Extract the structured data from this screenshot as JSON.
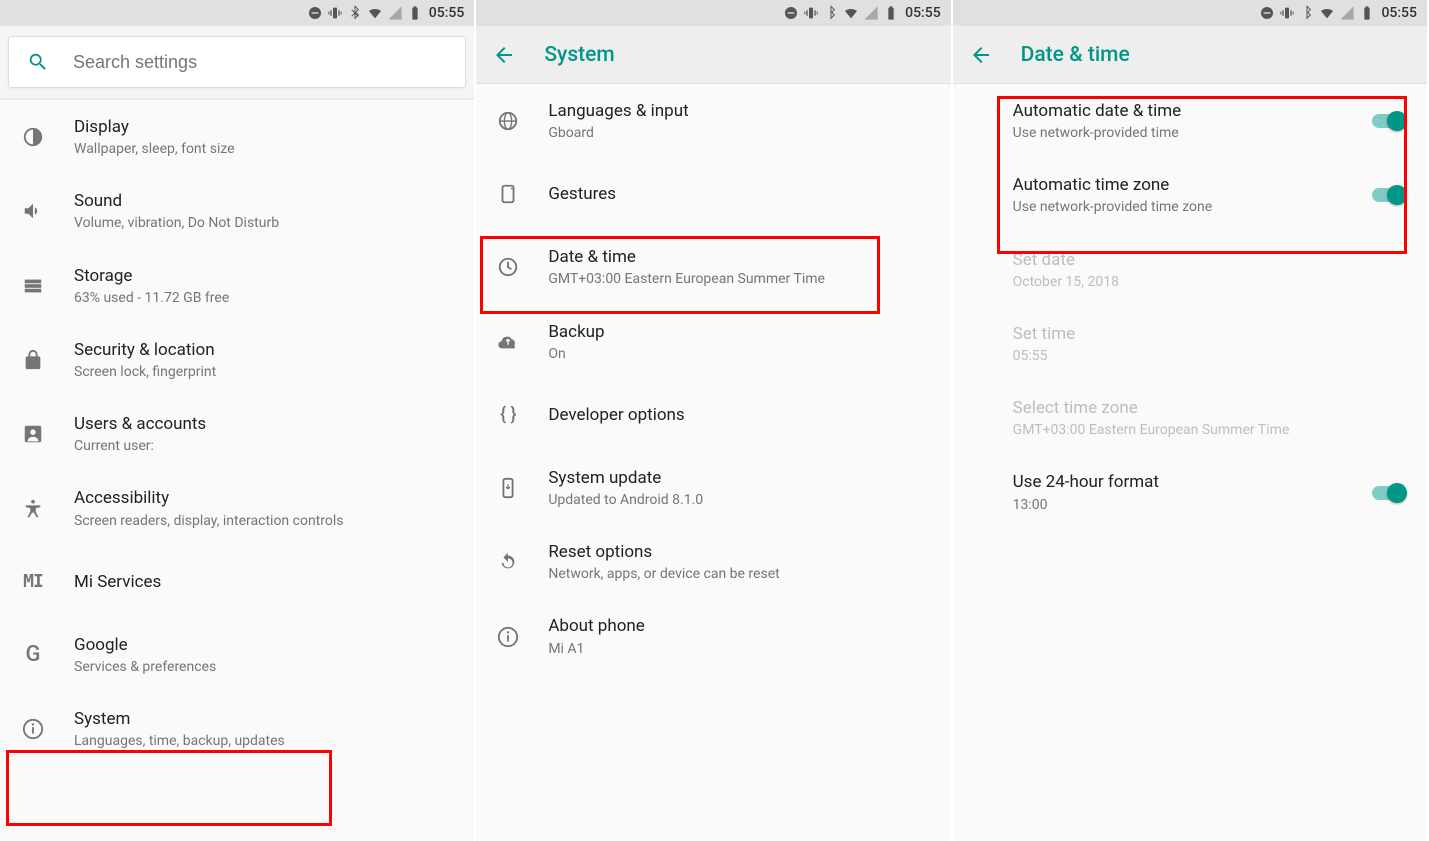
{
  "status": {
    "time": "05:55"
  },
  "panel1": {
    "search_placeholder": "Search settings",
    "items": [
      {
        "title": "Display",
        "subtitle": "Wallpaper, sleep, font size"
      },
      {
        "title": "Sound",
        "subtitle": "Volume, vibration, Do Not Disturb"
      },
      {
        "title": "Storage",
        "subtitle": "63% used - 11.72 GB free"
      },
      {
        "title": "Security & location",
        "subtitle": "Screen lock, fingerprint"
      },
      {
        "title": "Users & accounts",
        "subtitle": "Current user:"
      },
      {
        "title": "Accessibility",
        "subtitle": "Screen readers, display, interaction controls"
      },
      {
        "title": "Mi Services",
        "subtitle": ""
      },
      {
        "title": "Google",
        "subtitle": "Services & preferences"
      },
      {
        "title": "System",
        "subtitle": "Languages, time, backup, updates"
      }
    ]
  },
  "panel2": {
    "title": "System",
    "items": [
      {
        "title": "Languages & input",
        "subtitle": "Gboard"
      },
      {
        "title": "Gestures",
        "subtitle": ""
      },
      {
        "title": "Date & time",
        "subtitle": "GMT+03:00 Eastern European Summer Time"
      },
      {
        "title": "Backup",
        "subtitle": "On"
      },
      {
        "title": "Developer options",
        "subtitle": ""
      },
      {
        "title": "System update",
        "subtitle": "Updated to Android 8.1.0"
      },
      {
        "title": "Reset options",
        "subtitle": "Network, apps, or device can be reset"
      },
      {
        "title": "About phone",
        "subtitle": "Mi A1"
      }
    ]
  },
  "panel3": {
    "title": "Date & time",
    "items": [
      {
        "title": "Automatic date & time",
        "subtitle": "Use network-provided time",
        "toggle": true
      },
      {
        "title": "Automatic time zone",
        "subtitle": "Use network-provided time zone",
        "toggle": true
      },
      {
        "title": "Set date",
        "subtitle": "October 15, 2018",
        "disabled": true
      },
      {
        "title": "Set time",
        "subtitle": "05:55",
        "disabled": true
      },
      {
        "title": "Select time zone",
        "subtitle": "GMT+03:00 Eastern European Summer Time",
        "disabled": true
      },
      {
        "title": "Use 24-hour format",
        "subtitle": "13:00",
        "toggle": true
      }
    ]
  }
}
